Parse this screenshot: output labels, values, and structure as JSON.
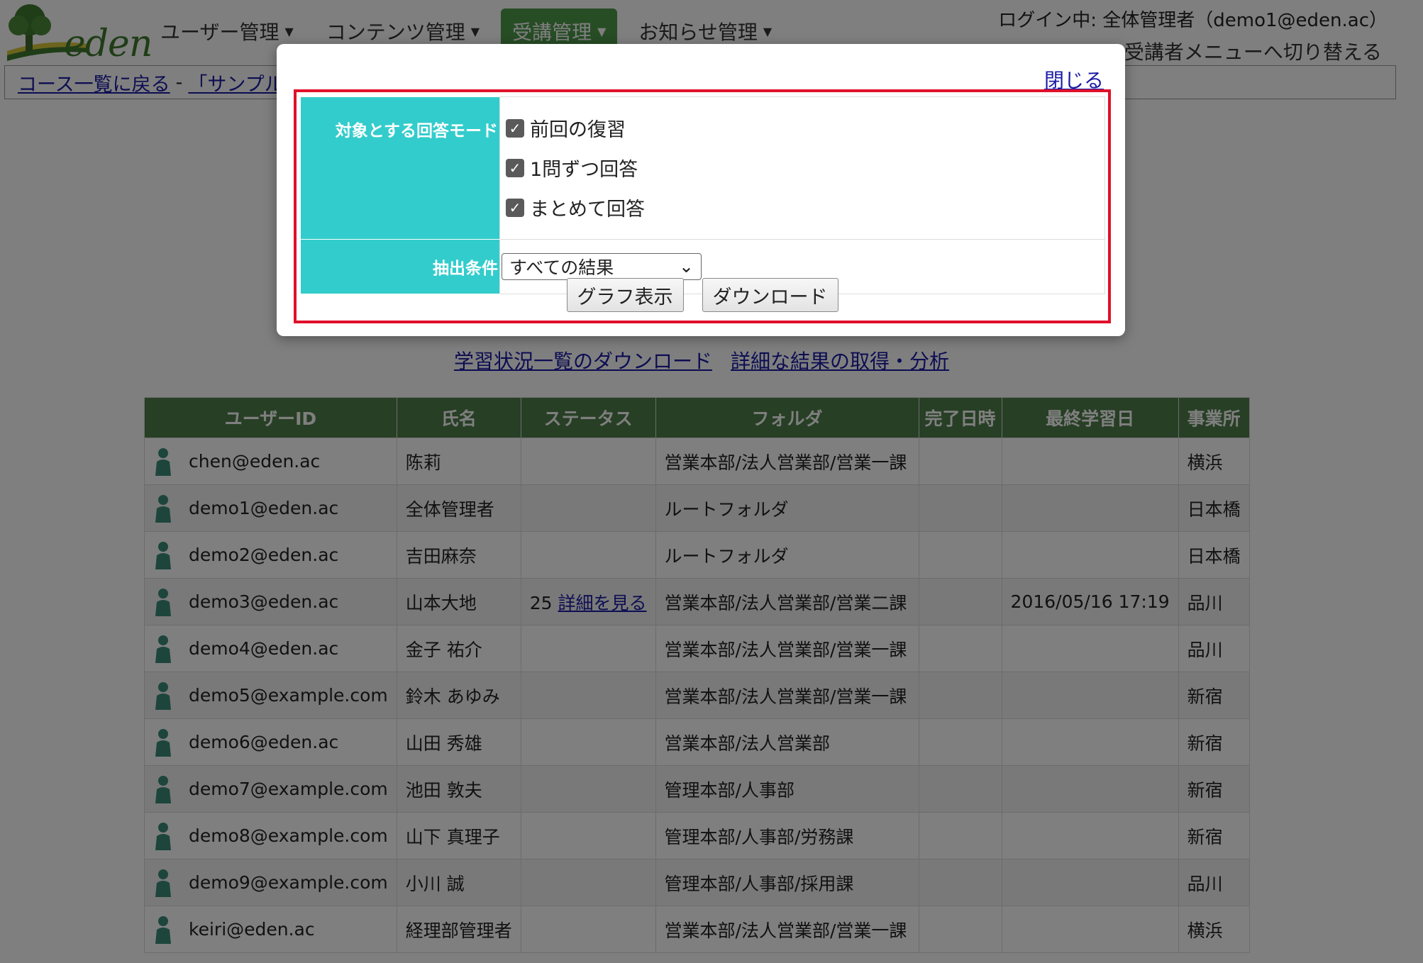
{
  "header": {
    "logo_text": "eden",
    "nav": [
      {
        "label": "ユーザー管理"
      },
      {
        "label": "コンテンツ管理"
      },
      {
        "label": "受講管理"
      },
      {
        "label": "お知らせ管理"
      }
    ],
    "login_info": "ログイン中: 全体管理者（demo1@eden.ac）",
    "switch_menu": "受講者メニューへ切り替える"
  },
  "breadcrumb": {
    "back": "コース一覧に戻る",
    "separator": "-",
    "current": "「サンプル"
  },
  "links": {
    "download_status": "学習状況一覧のダウンロード",
    "detail_analysis": "詳細な結果の取得・分析"
  },
  "table": {
    "headers": [
      "ユーザーID",
      "氏名",
      "ステータス",
      "フォルダ",
      "完了日時",
      "最終学習日",
      "事業所"
    ],
    "rows": [
      {
        "uid": "chen@eden.ac",
        "name": "陈莉",
        "status": "",
        "detail": "",
        "folder": "営業本部/法人営業部/営業一課",
        "done": "",
        "last": "",
        "office": "横浜"
      },
      {
        "uid": "demo1@eden.ac",
        "name": "全体管理者",
        "status": "",
        "detail": "",
        "folder": "ルートフォルダ",
        "done": "",
        "last": "",
        "office": "日本橋"
      },
      {
        "uid": "demo2@eden.ac",
        "name": "吉田麻奈",
        "status": "",
        "detail": "",
        "folder": "ルートフォルダ",
        "done": "",
        "last": "",
        "office": "日本橋"
      },
      {
        "uid": "demo3@eden.ac",
        "name": "山本大地",
        "status": "25",
        "detail": "詳細を見る",
        "folder": "営業本部/法人営業部/営業二課",
        "done": "",
        "last": "2016/05/16 17:19",
        "office": "品川"
      },
      {
        "uid": "demo4@eden.ac",
        "name": "金子 祐介",
        "status": "",
        "detail": "",
        "folder": "営業本部/法人営業部/営業一課",
        "done": "",
        "last": "",
        "office": "品川"
      },
      {
        "uid": "demo5@example.com",
        "name": "鈴木 あゆみ",
        "status": "",
        "detail": "",
        "folder": "営業本部/法人営業部/営業一課",
        "done": "",
        "last": "",
        "office": "新宿"
      },
      {
        "uid": "demo6@eden.ac",
        "name": "山田 秀雄",
        "status": "",
        "detail": "",
        "folder": "営業本部/法人営業部",
        "done": "",
        "last": "",
        "office": "新宿"
      },
      {
        "uid": "demo7@example.com",
        "name": "池田 敦夫",
        "status": "",
        "detail": "",
        "folder": "管理本部/人事部",
        "done": "",
        "last": "",
        "office": "新宿"
      },
      {
        "uid": "demo8@example.com",
        "name": "山下 真理子",
        "status": "",
        "detail": "",
        "folder": "管理本部/人事部/労務課",
        "done": "",
        "last": "",
        "office": "新宿"
      },
      {
        "uid": "demo9@example.com",
        "name": "小川 誠",
        "status": "",
        "detail": "",
        "folder": "管理本部/人事部/採用課",
        "done": "",
        "last": "",
        "office": "品川"
      },
      {
        "uid": "keiri@eden.ac",
        "name": "経理部管理者",
        "status": "",
        "detail": "",
        "folder": "営業本部/法人営業部/営業一課",
        "done": "",
        "last": "",
        "office": "横浜"
      }
    ]
  },
  "modal": {
    "close": "閉じる",
    "mode_label": "対象とする回答モード",
    "modes": [
      {
        "label": "前回の復習",
        "checked": true
      },
      {
        "label": "1問ずつ回答",
        "checked": true
      },
      {
        "label": "まとめて回答",
        "checked": true
      }
    ],
    "extract_label": "抽出条件",
    "extract_value": "すべての結果",
    "graph_button": "グラフ表示",
    "download_button": "ダウンロード"
  },
  "colors": {
    "accent_green": "#4f9a4a",
    "table_header": "#4f7f4a",
    "form_label_bg": "#33cccc",
    "highlight": "#e0102a"
  }
}
